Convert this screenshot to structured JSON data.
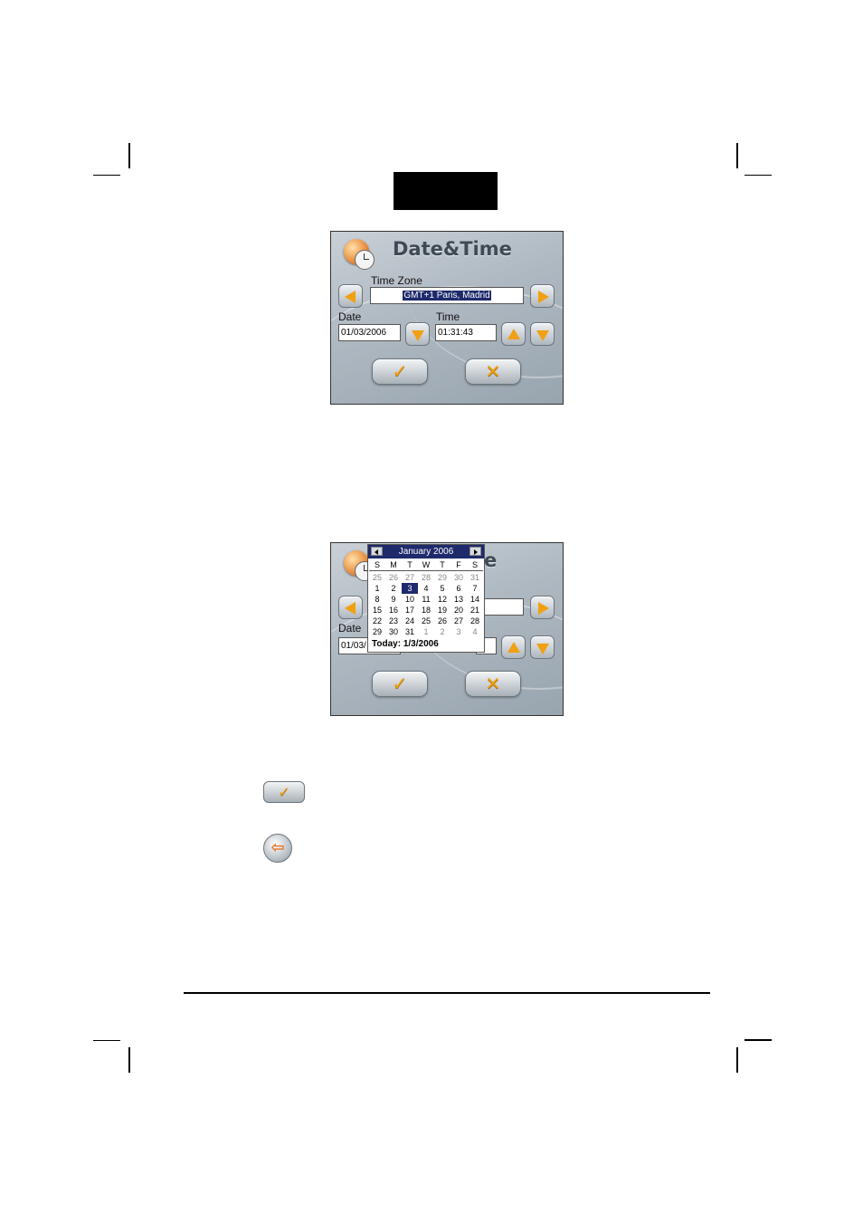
{
  "screen1": {
    "title": "Date&Time",
    "timezone_label": "Time Zone",
    "timezone_value": "GMT+1 Paris, Madrid",
    "date_label": "Date",
    "date_value": "01/03/2006",
    "time_label": "Time",
    "time_value": "01:31:43",
    "ok_icon": "check-icon",
    "cancel_icon": "cross-icon"
  },
  "screen2": {
    "title_visible": "e",
    "date_label": "Date",
    "date_value": "01/03/",
    "calendar": {
      "month_title": "January 2006",
      "weekdays": [
        "S",
        "M",
        "T",
        "W",
        "T",
        "F",
        "S"
      ],
      "weeks": [
        [
          "25",
          "26",
          "27",
          "28",
          "29",
          "30",
          "31"
        ],
        [
          "1",
          "2",
          "3",
          "4",
          "5",
          "6",
          "7"
        ],
        [
          "8",
          "9",
          "10",
          "11",
          "12",
          "13",
          "14"
        ],
        [
          "15",
          "16",
          "17",
          "18",
          "19",
          "20",
          "21"
        ],
        [
          "22",
          "23",
          "24",
          "25",
          "26",
          "27",
          "28"
        ],
        [
          "29",
          "30",
          "31",
          "1",
          "2",
          "3",
          "4"
        ]
      ],
      "selected_day": "3",
      "today_label": "Today:",
      "today_value": "1/3/2006"
    }
  },
  "legend": {
    "ok_icon": "check-icon",
    "back_icon": "back-arrow-icon"
  },
  "colors": {
    "accent": "#f0a010",
    "selection": "#1e2a6b",
    "panel": "#aeb8c1"
  }
}
